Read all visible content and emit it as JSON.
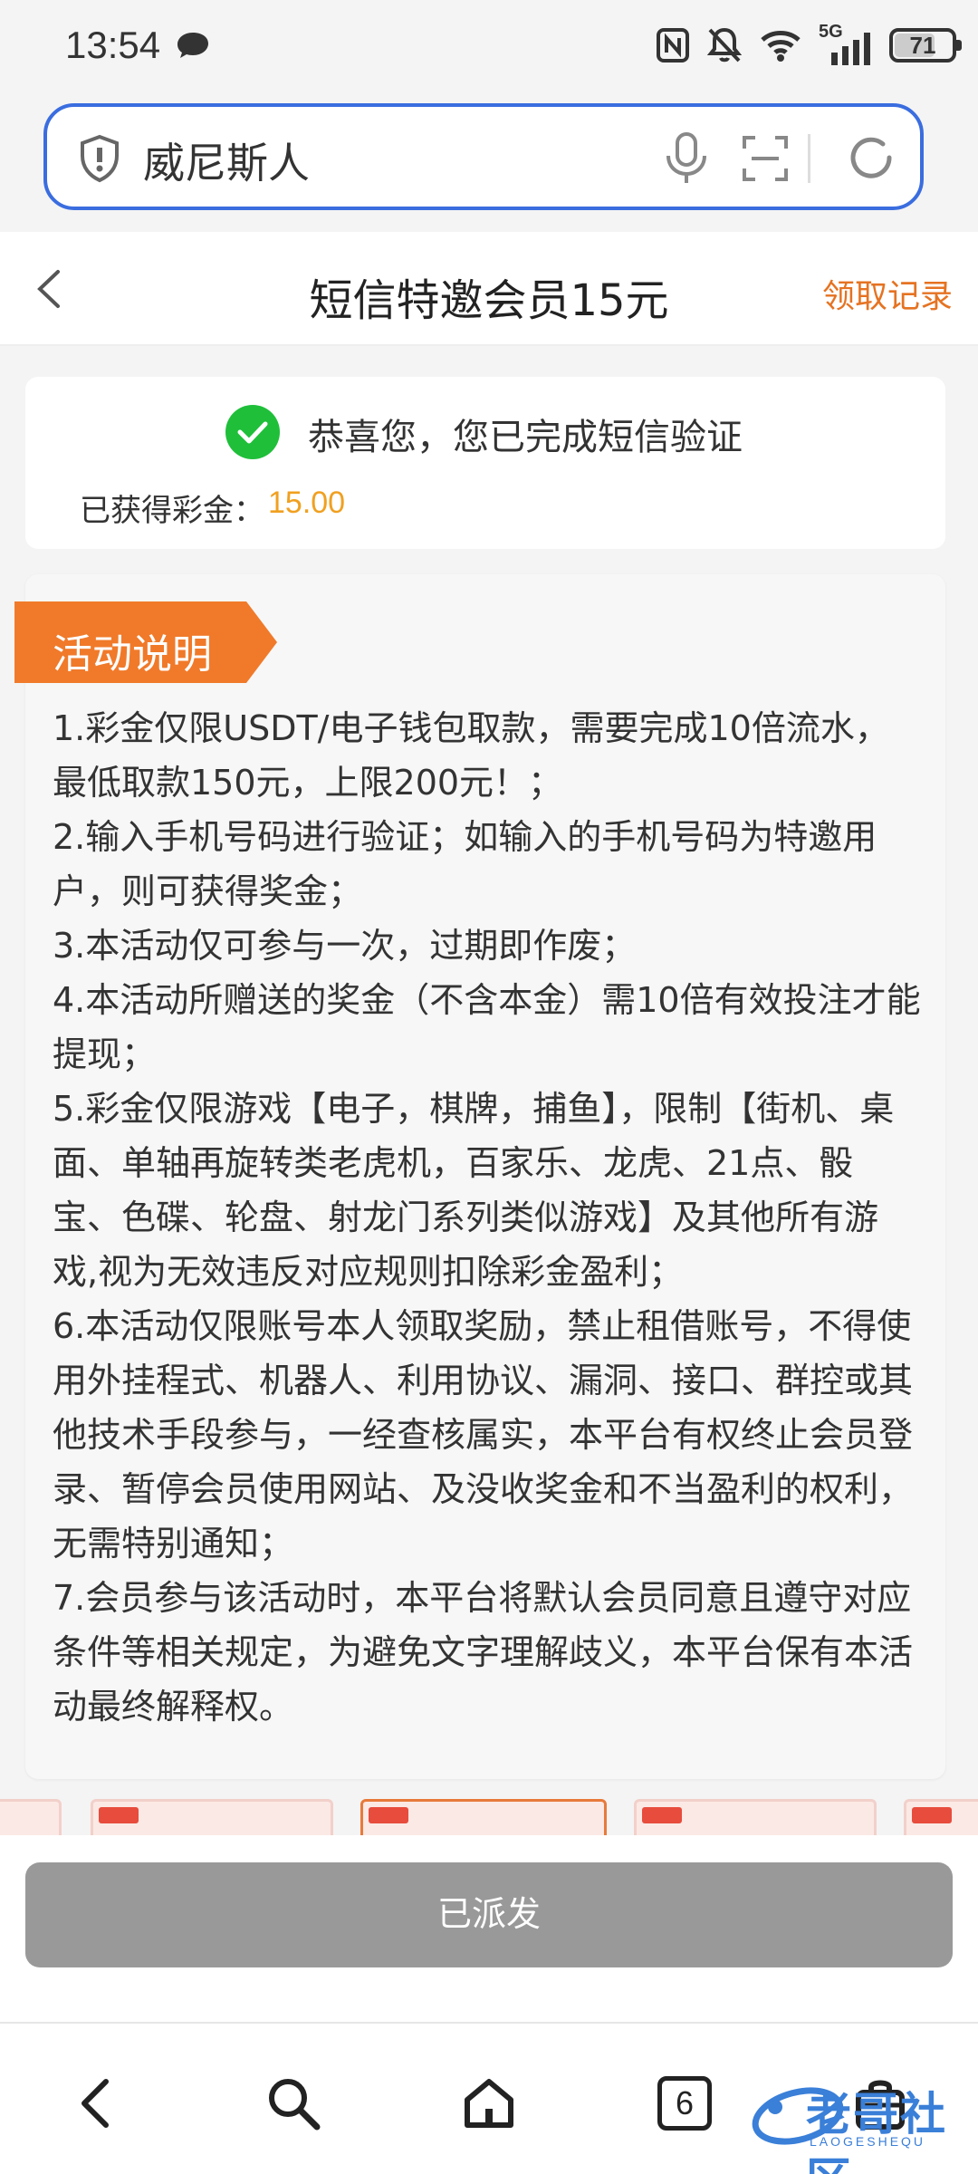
{
  "status_bar": {
    "time": "13:54",
    "network": "5G",
    "battery": "71",
    "battery_level": 0.71
  },
  "url_bar": {
    "text": "威尼斯人"
  },
  "header": {
    "title": "短信特邀会员15元",
    "link": "领取记录"
  },
  "success": {
    "message": "恭喜您，您已完成短信验证",
    "bonus_label": "已获得彩金：",
    "bonus_value": "15.00"
  },
  "activity": {
    "title": "活动说明",
    "rules": [
      "1.彩金仅限USDT/电子钱包取款，需要完成10倍流水，最低取款150元，上限200元！；",
      "2.输入手机号码进行验证；如输入的手机号码为特邀用户，则可获得奖金；",
      "3.本活动仅可参与一次，过期即作废；",
      "4.本活动所赠送的奖金（不含本金）需10倍有效投注才能提现；",
      "5.彩金仅限游戏【电子，棋牌，捕鱼】，限制【街机、桌面、单轴再旋转类老虎机，百家乐、龙虎、21点、骰宝、色碟、轮盘、射龙门系列类似游戏】及其他所有游戏,视为无效违反对应规则扣除彩金盈利；",
      "6.本活动仅限账号本人领取奖励，禁止租借账号，不得使用外挂程式、机器人、利用协议、漏洞、接口、群控或其他技术手段参与，一经查核属实，本平台有权终止会员登录、暂停会员使用网站、及没收奖金和不当盈利的权利，无需特别通知；",
      "7.会员参与该活动时，本平台将默认会员同意且遵守对应条件等相关规定，为避免文字理解歧义，本平台保有本活动最终解释权。"
    ]
  },
  "button": {
    "label": "已派发"
  },
  "bottom_nav": {
    "tabs_count": "6"
  },
  "watermark": {
    "text": "老哥社区",
    "sub": "LAOGESHEQU"
  },
  "colors": {
    "accent_blue": "#3a6ddf",
    "accent_orange": "#e57322",
    "success_green": "#1fbf3a",
    "bonus_gold": "#f0a020",
    "ribbon_orange": "#f07a2a",
    "button_gray": "#999999"
  }
}
